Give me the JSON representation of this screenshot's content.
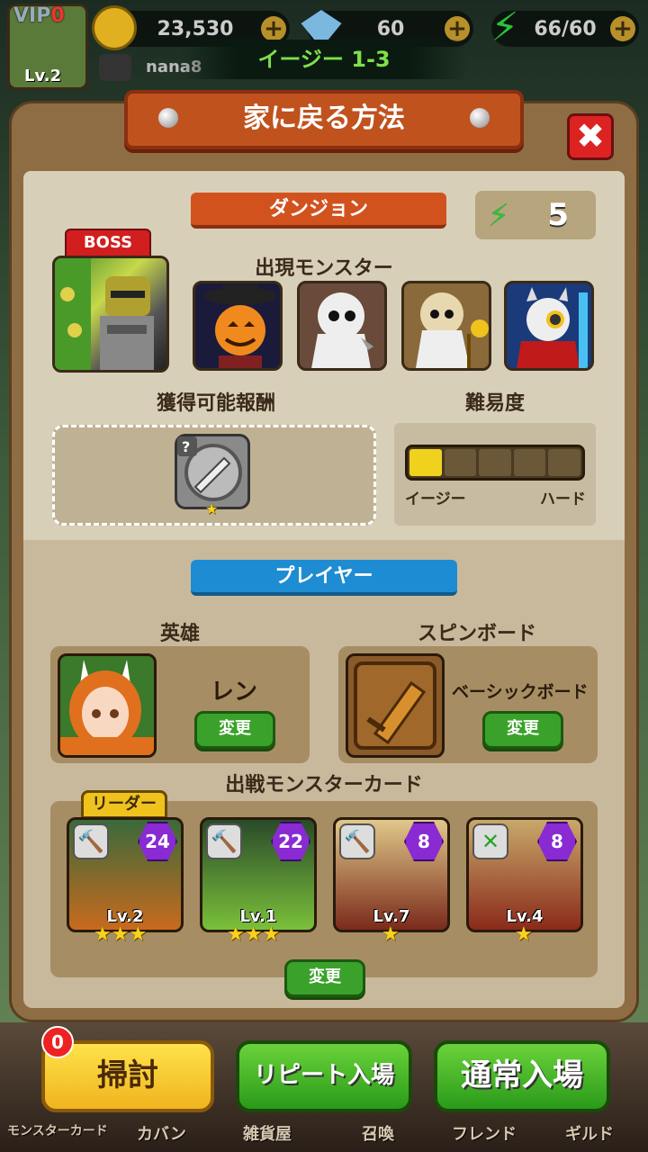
{
  "hud": {
    "vip_label": "VIP",
    "vip_level": "0",
    "player_level": "Lv.2",
    "gold": "23,530",
    "gems": "60",
    "stamina": "66/60",
    "username": "nana8",
    "stage_title": "イージー 1-3"
  },
  "modal": {
    "title": "家に戻る方法",
    "close_icon": "close-icon",
    "dungeon_tab": "ダンジョン",
    "energy_cost": "5",
    "boss_label": "BOSS",
    "monsters_label": "出現モンスター",
    "rewards_label": "獲得可能報酬",
    "difficulty_label": "難易度",
    "difficulty_level": 1,
    "difficulty_max": 5,
    "difficulty_easy": "イージー",
    "difficulty_hard": "ハード",
    "reward_unknown": "?",
    "player_tab": "プレイヤー",
    "hero_label": "英雄",
    "hero_name": "レン",
    "hero_change": "変更",
    "board_label": "スピンボード",
    "board_name": "ベーシックボード",
    "board_change": "変更",
    "cards_label": "出戦モンスターカード",
    "leader_label": "リーダー",
    "cards": [
      {
        "cost": "24",
        "level": "Lv.2",
        "stars": "★★★"
      },
      {
        "cost": "22",
        "level": "Lv.1",
        "stars": "★★★"
      },
      {
        "cost": "8",
        "level": "Lv.7",
        "stars": "★"
      },
      {
        "cost": "8",
        "level": "Lv.4",
        "stars": "★"
      }
    ],
    "cards_change": "変更"
  },
  "actions": {
    "sweep_badge": "0",
    "sweep": "掃討",
    "repeat": "リピート入場",
    "normal": "通常入場"
  },
  "nav": {
    "monster_card": "モンスターカード",
    "bag": "カバン",
    "shop": "雑貨屋",
    "summon": "召喚",
    "friend": "フレンド",
    "guild": "ギルド"
  },
  "colors": {
    "accent_orange": "#c0521e",
    "accent_blue": "#1e8cd2",
    "button_green": "#3aa22a",
    "difficulty_fill": "#f0d21e"
  }
}
